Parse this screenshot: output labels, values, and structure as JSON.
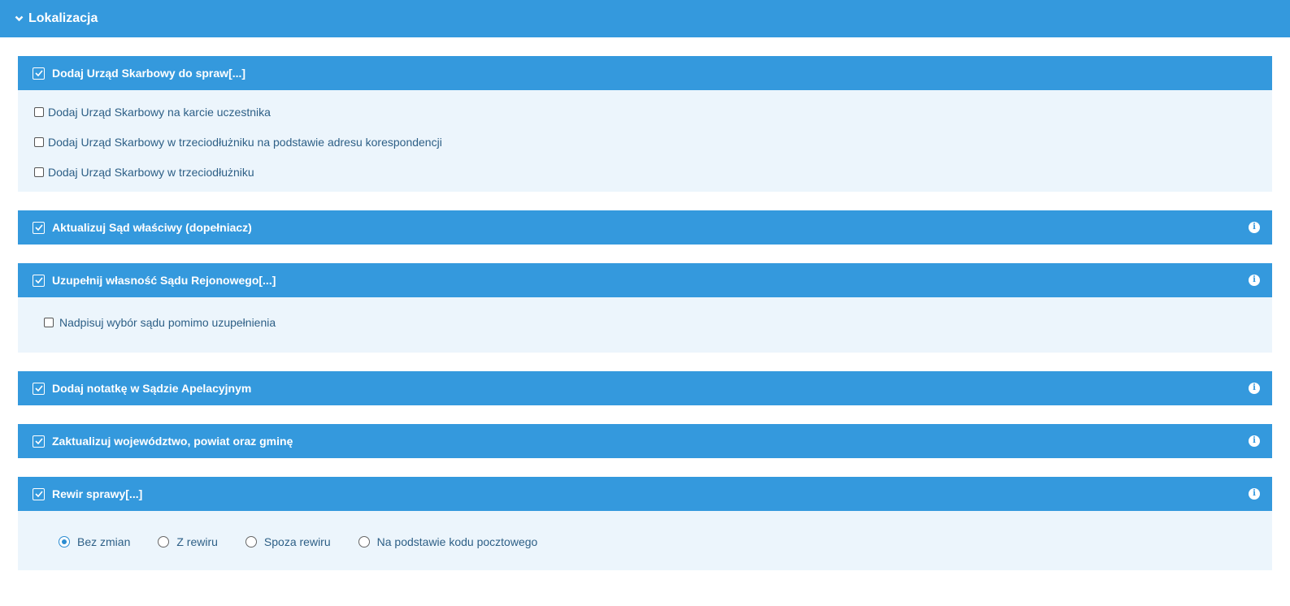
{
  "section": {
    "title": "Lokalizacja"
  },
  "panels": {
    "p1": {
      "title": "Dodaj Urząd Skarbowy do spraw",
      "more": "[...]",
      "options": [
        "Dodaj Urząd Skarbowy na karcie uczestnika",
        "Dodaj Urząd Skarbowy w trzeciodłużniku na podstawie adresu korespondencji",
        "Dodaj Urząd Skarbowy w trzeciodłużniku"
      ]
    },
    "p2": {
      "title": "Aktualizuj Sąd właściwy (dopełniacz)"
    },
    "p3": {
      "title": "Uzupełnij własność Sądu Rejonowego",
      "more": "[...]",
      "options": [
        "Nadpisuj wybór sądu pomimo uzupełnienia"
      ]
    },
    "p4": {
      "title": "Dodaj notatkę w Sądzie Apelacyjnym"
    },
    "p5": {
      "title": "Zaktualizuj województwo, powiat oraz gminę"
    },
    "p6": {
      "title": "Rewir sprawy",
      "more": "[...]",
      "radios": [
        "Bez zmian",
        "Z rewiru",
        "Spoza rewiru",
        "Na podstawie kodu pocztowego"
      ],
      "selected": "Bez zmian"
    }
  },
  "info_symbol": "i",
  "colors": {
    "header": "#3499dd",
    "body": "#ecf5fc",
    "text": "#2d5f86"
  },
  "icons": {
    "check": "check-icon",
    "info": "info-icon",
    "chevron": "chevron-down-icon"
  }
}
